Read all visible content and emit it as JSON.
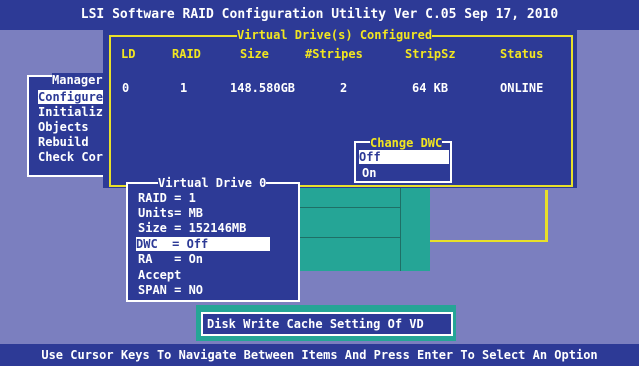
{
  "title": "LSI Software RAID Configuration Utility Ver C.05 Sep 17, 2010",
  "status_bar": "Use Cursor Keys To Navigate Between Items And Press Enter To Select An Option",
  "main_menu": {
    "title": "Manager",
    "items": [
      "Configure",
      "Initializ",
      "Objects",
      "Rebuild",
      "Check Cor"
    ],
    "selected_index": 0
  },
  "vd_configured": {
    "title": "Virtual Drive(s) Configured",
    "columns": [
      "LD",
      "RAID",
      "Size",
      "#Stripes",
      "StripSz",
      "Status"
    ],
    "rows": [
      [
        "0",
        "1",
        "148.580GB",
        "2",
        "64 KB",
        "ONLINE"
      ]
    ]
  },
  "change_dwc": {
    "title": "Change DWC",
    "options": [
      "Off",
      "On"
    ],
    "selected_index": 0
  },
  "virtual_drive": {
    "title": "Virtual Drive 0",
    "items": [
      "RAID = 1",
      "Units= MB",
      "Size = 152146MB",
      "DWC  = Off",
      "RA   = On",
      "Accept",
      "SPAN = NO"
    ],
    "selected_index": 3
  },
  "help_text": "Disk Write Cache Setting Of VD",
  "colors": {
    "background": "#7b7fbf",
    "panel": "#2d3a96",
    "frame_yellow": "#e8e02a",
    "text_yellow": "#f2e620",
    "teal": "#25a596",
    "highlight": "#ffffff"
  }
}
